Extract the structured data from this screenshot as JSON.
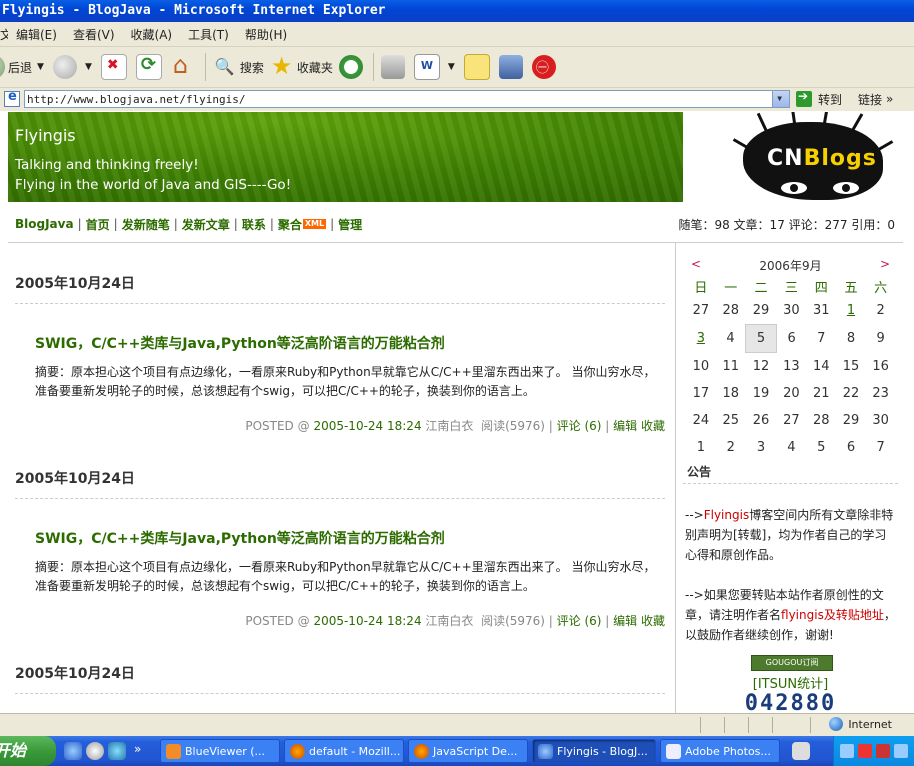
{
  "window": {
    "title": "Flyingis - BlogJava - Microsoft Internet Explorer"
  },
  "menu": [
    "编辑(E)",
    "查看(V)",
    "收藏(A)",
    "工具(T)",
    "帮助(H)"
  ],
  "menu_first": "文件(F)",
  "toolbar": {
    "back_label": "后退",
    "search_label": "搜索",
    "favorites_label": "收藏夹"
  },
  "address": {
    "url": "http://www.blogjava.net/flyingis/",
    "go_label": "转到",
    "links_label": "链接"
  },
  "blog": {
    "title": "Flyingis",
    "tagline1": "Talking and thinking freely!",
    "tagline2": "Flying in the world of Java and GIS----Go!",
    "logo_text_c": "CN",
    "logo_text_b": "Blogs"
  },
  "nav": {
    "items": [
      "BlogJava",
      "首页",
      "发新随笔",
      "发新文章",
      "联系",
      "聚合",
      "管理"
    ],
    "xml_badge": "XML",
    "stats": "随笔：98 文章：17 评论：277 引用：0"
  },
  "posts": [
    {
      "date": "2005年10月24日",
      "title": "SWIG，C/C++类库与Java,Python等泛高阶语言的万能粘合剂",
      "summary": "摘要：原本担心这个项目有点边缘化，一看原来Ruby和Python早就靠它从C/C++里溜东西出来了。 当你山穷水尽，准备要重新发明轮子的时候，总该想起有个swig，可以把C/C++的轮子，换装到你的语言上。",
      "posted_prefix": "POSTED @",
      "posted_time": "2005-10-24 18:24",
      "author": "江南白衣",
      "reads": "阅读(5976)",
      "comments": "评论 (6)",
      "edit": "编辑",
      "collect": "收藏"
    },
    {
      "date": "2005年10月24日",
      "title": "SWIG，C/C++类库与Java,Python等泛高阶语言的万能粘合剂",
      "summary": "摘要：原本担心这个项目有点边缘化，一看原来Ruby和Python早就靠它从C/C++里溜东西出来了。 当你山穷水尽，准备要重新发明轮子的时候，总该想起有个swig，可以把C/C++的轮子，换装到你的语言上。",
      "posted_prefix": "POSTED @",
      "posted_time": "2005-10-24 18:24",
      "author": "江南白衣",
      "reads": "阅读(5976)",
      "comments": "评论 (6)",
      "edit": "编辑",
      "collect": "收藏"
    },
    {
      "date": "2005年10月24日"
    }
  ],
  "calendar": {
    "prev": "<",
    "next": ">",
    "month": "2006年9月",
    "weekdays": [
      "日",
      "一",
      "二",
      "三",
      "四",
      "五",
      "六"
    ],
    "weeks": [
      [
        "27",
        "28",
        "29",
        "30",
        "31",
        "1",
        "2"
      ],
      [
        "3",
        "4",
        "5",
        "6",
        "7",
        "8",
        "9"
      ],
      [
        "10",
        "11",
        "12",
        "13",
        "14",
        "15",
        "16"
      ],
      [
        "17",
        "18",
        "19",
        "20",
        "21",
        "22",
        "23"
      ],
      [
        "24",
        "25",
        "26",
        "27",
        "28",
        "29",
        "30"
      ],
      [
        "1",
        "2",
        "3",
        "4",
        "5",
        "6",
        "7"
      ]
    ],
    "linked_days": [
      "1",
      "3"
    ],
    "today": "5"
  },
  "notice": {
    "title": "公告",
    "p1_prefix": "-->",
    "p1_red": "Flyingis",
    "p1_rest": "博客空间内所有文章除非特别声明为[转载]，均为作者自己的学习心得和原创作品。",
    "p2_prefix": "-->如果您要转贴本站作者原创性的文章，请注明作者名",
    "p2_red": "flyingis及转贴地址",
    "p2_rest": "，以鼓励作者继续创作，谢谢!",
    "gougou": "GOUGOU订阅",
    "itsun": "[ITSUN统计]",
    "counter": "042880"
  },
  "status": {
    "zone": "Internet"
  },
  "taskbar": {
    "start": "开始",
    "tasks": [
      "BlueViewer (...",
      "default - Mozill...",
      "JavaScript De...",
      "Flyingis - BlogJ...",
      "Adobe Photos..."
    ]
  },
  "colors": {
    "blog_green": "#2c6b00",
    "notice_red": "#cc0000",
    "xp_blue": "#245edb"
  }
}
